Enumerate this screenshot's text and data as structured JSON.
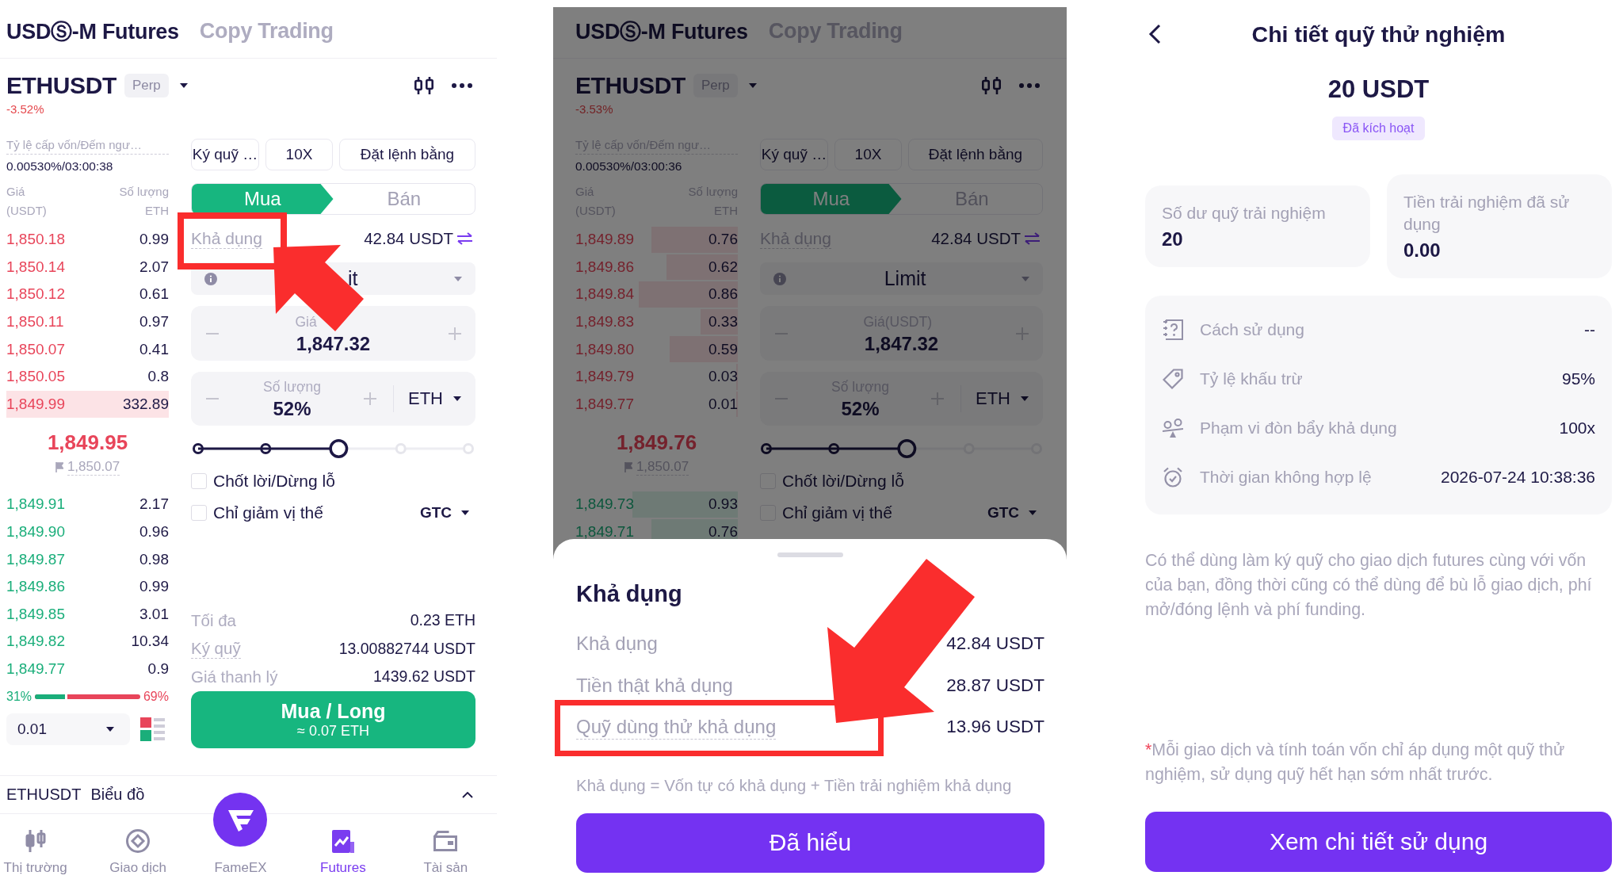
{
  "screens": [
    {
      "kind": "trading",
      "tabs": [
        {
          "label": "USDⓈ-M Futures",
          "selected": true
        },
        {
          "label": "Copy Trading",
          "selected": false
        }
      ],
      "symbol": "ETHUSDT",
      "contract_badge": "Perp",
      "change": "-3.52%",
      "funding_label": "Tỷ lệ cấp vốn/Đếm ngư…",
      "funding_value": "0.00530%/03:00:38",
      "price_header": "Giá (USDT)",
      "qty_header": "Số lượng ETH",
      "asks": [
        {
          "price": "1,850.18",
          "qty": "0.99",
          "highlighted": false
        },
        {
          "price": "1,850.14",
          "qty": "2.07",
          "highlighted": false
        },
        {
          "price": "1,850.12",
          "qty": "0.61",
          "highlighted": false
        },
        {
          "price": "1,850.11",
          "qty": "0.97",
          "highlighted": false
        },
        {
          "price": "1,850.07",
          "qty": "0.41",
          "highlighted": false
        },
        {
          "price": "1,850.05",
          "qty": "0.8",
          "highlighted": false
        },
        {
          "price": "1,849.99",
          "qty": "332.89",
          "highlighted": true
        }
      ],
      "last_price": "1,849.95",
      "mark_price": "1,850.07",
      "bids": [
        {
          "price": "1,849.91",
          "qty": "2.17"
        },
        {
          "price": "1,849.90",
          "qty": "0.96"
        },
        {
          "price": "1,849.87",
          "qty": "0.98"
        },
        {
          "price": "1,849.86",
          "qty": "0.99"
        },
        {
          "price": "1,849.85",
          "qty": "3.01"
        },
        {
          "price": "1,849.82",
          "qty": "10.34"
        },
        {
          "price": "1,849.77",
          "qty": "0.9"
        }
      ],
      "ratio": {
        "buy": "31%",
        "sell": "69%",
        "level": 0.31
      },
      "precision": "0.01",
      "toolbar": [
        "Ký quỹ …",
        "10X",
        "Đặt lệnh bằng"
      ],
      "sides": [
        {
          "label": "Mua",
          "selected": true
        },
        {
          "label": "Bán",
          "selected": false
        }
      ],
      "available": {
        "label": "Khả dụng",
        "value": "42.84 USDT"
      },
      "order_type": "it",
      "price_field": {
        "label": "Giá",
        "value": "1,847.32"
      },
      "amount_field": {
        "label": "Số lượng",
        "value": "52%",
        "unit": "ETH"
      },
      "slider": {
        "level": 0.52
      },
      "options": [
        {
          "label": "Chốt lời/Dừng lỗ",
          "checked": false
        },
        {
          "label": "Chỉ giảm vị thế",
          "checked": false
        }
      ],
      "time_in_force": "GTC",
      "summary": [
        {
          "label": "Tối đa",
          "value": "0.23 ETH",
          "hint": false
        },
        {
          "label": "Ký quỹ",
          "value": "13.00882744 USDT",
          "hint": true
        },
        {
          "label": "Giá thanh lý",
          "value": "1439.62 USDT",
          "hint": false
        }
      ],
      "submit": {
        "label": "Mua / Long",
        "sub": "≈ 0.07 ETH"
      },
      "chart_bar": {
        "symbol": "ETHUSDT",
        "label": "Biểu đồ"
      },
      "nav": [
        {
          "label": "Thị trường",
          "kind": "tab",
          "selected": false
        },
        {
          "label": "Giao dịch",
          "kind": "tab",
          "selected": false
        },
        {
          "label": "FameEX",
          "kind": "center",
          "selected": false
        },
        {
          "label": "Futures",
          "kind": "tab",
          "selected": true
        },
        {
          "label": "Tài sản",
          "kind": "tab",
          "selected": false
        }
      ],
      "annotations": [
        {
          "kind": "highlight-box"
        },
        {
          "kind": "arrow"
        }
      ]
    },
    {
      "kind": "trading",
      "tabs": [
        {
          "label": "USDⓈ-M Futures",
          "selected": true
        },
        {
          "label": "Copy Trading",
          "selected": false
        }
      ],
      "symbol": "ETHUSDT",
      "contract_badge": "Perp",
      "change": "-3.53%",
      "funding_label": "Tỷ lệ cấp vốn/Đếm ngư…",
      "funding_value": "0.00530%/03:00:36",
      "price_header": "Giá (USDT)",
      "qty_header": "Số lượng ETH",
      "asks": [
        {
          "price": "1,849.89",
          "qty": "0.76",
          "level": 0.53
        },
        {
          "price": "1,849.86",
          "qty": "0.62",
          "level": 0.44
        },
        {
          "price": "1,849.84",
          "qty": "0.86",
          "level": 0.61
        },
        {
          "price": "1,849.83",
          "qty": "0.33",
          "level": 0.23
        },
        {
          "price": "1,849.80",
          "qty": "0.59",
          "level": 0.42
        },
        {
          "price": "1,849.79",
          "qty": "0.03",
          "level": 0.01
        },
        {
          "price": "1,849.77",
          "qty": "0.01",
          "level": 0.01
        }
      ],
      "last_price": "1,849.76",
      "mark_price": "1,850.07",
      "bids": [
        {
          "price": "1,849.73",
          "qty": "0.93",
          "level": 0.65
        },
        {
          "price": "1,849.71",
          "qty": "0.76",
          "level": 0.53
        }
      ],
      "toolbar": [
        "Ký quỹ …",
        "10X",
        "Đặt lệnh bằng"
      ],
      "sides": [
        {
          "label": "Mua",
          "selected": true
        },
        {
          "label": "Bán",
          "selected": false
        }
      ],
      "available": {
        "label": "Khả dụng",
        "value": "42.84 USDT"
      },
      "order_type": "Limit",
      "price_field": {
        "label": "Giá(USDT)",
        "value": "1,847.32"
      },
      "amount_field": {
        "label": "Số lượng",
        "value": "52%",
        "unit": "ETH"
      },
      "slider": {
        "level": 0.52
      },
      "options": [
        {
          "label": "Chốt lời/Dừng lỗ",
          "checked": false
        },
        {
          "label": "Chỉ giảm vị thế",
          "checked": false
        }
      ],
      "time_in_force": "GTC",
      "sheet": {
        "title": "Khả dụng",
        "rows": [
          {
            "label": "Khả dụng",
            "value": "42.84 USDT",
            "hint": false
          },
          {
            "label": "Tiền thật khả dụng",
            "value": "28.87 USDT",
            "hint": false
          },
          {
            "label": "Quỹ dùng thử khả dụng",
            "value": "13.96 USDT",
            "hint": true
          }
        ],
        "formula": "Khả dụng = Vốn tự có khả dụng + Tiền trải nghiệm khả dụng",
        "button": "Đã hiểu"
      },
      "annotations": [
        {
          "kind": "highlight-box"
        },
        {
          "kind": "arrow"
        }
      ]
    },
    {
      "kind": "fund_detail",
      "title": "Chi tiết quỹ thử nghiệm",
      "amount": "20 USDT",
      "status": "Đã kích hoạt",
      "stats": [
        {
          "label": "Số dư quỹ trải nghiệm",
          "value": "20"
        },
        {
          "label": "Tiền trải nghiệm đã sử dụng",
          "value": "0.00"
        }
      ],
      "details": [
        {
          "label": "Cách sử dụng",
          "value": "--"
        },
        {
          "label": "Tỷ lệ khấu trừ",
          "value": "95%"
        },
        {
          "label": "Phạm vi đòn bẩy khả dụng",
          "value": "100x"
        },
        {
          "label": "Thời gian không hợp lệ",
          "value": "2026-07-24 10:38:36"
        }
      ],
      "description": "Có thể dùng làm ký quỹ cho giao dịch futures cùng với vốn của bạn, đồng thời cũng có thể dùng để bù lỗ giao dịch, phí mở/đóng lệnh và phí funding.",
      "note_mark": "*",
      "note": "Mỗi giao dịch và tính toán vốn chỉ áp dụng một quỹ thử nghiệm, sử dụng quỹ hết hạn sớm nhất trước.",
      "button": "Xem chi tiết sử dụng"
    }
  ]
}
